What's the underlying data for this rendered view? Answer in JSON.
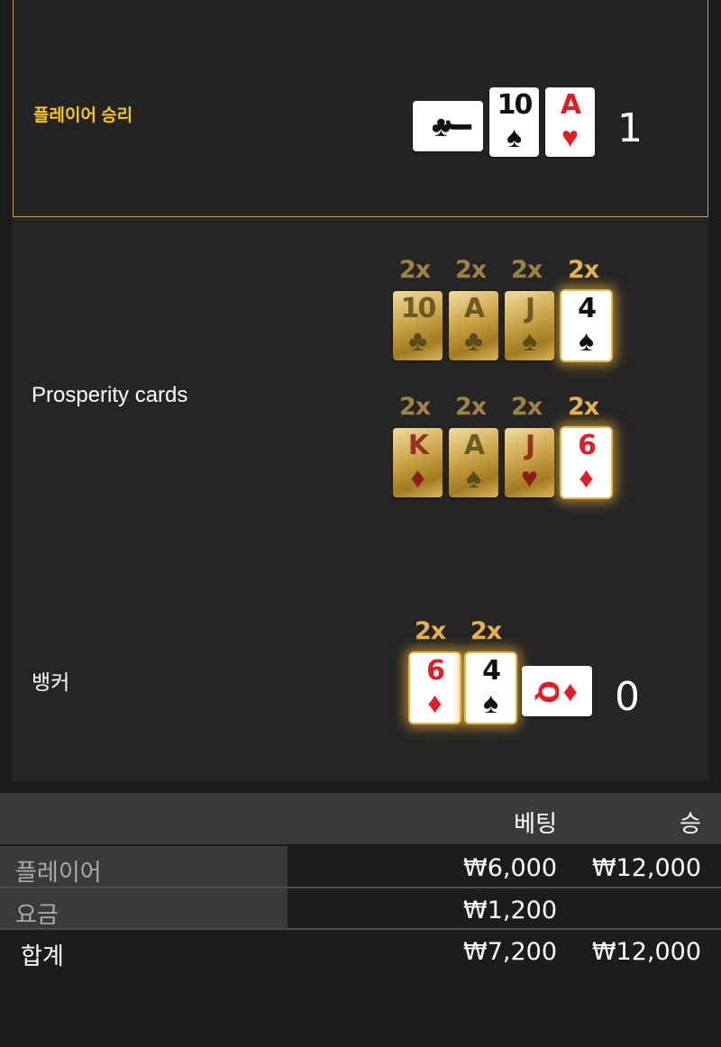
{
  "player": {
    "label": "플레이어 승리",
    "score": "1",
    "cards": [
      {
        "rank": "J",
        "suit": "♣",
        "color": "black",
        "orientation": "sideways"
      },
      {
        "rank": "10",
        "suit": "♠",
        "color": "black"
      },
      {
        "rank": "A",
        "suit": "♥",
        "color": "red"
      }
    ]
  },
  "prosperity": {
    "label": "Prosperity cards",
    "rows": [
      {
        "multipliers": [
          "2x",
          "2x",
          "2x",
          "2x"
        ],
        "cards": [
          {
            "rank": "10",
            "suit": "♣",
            "color": "black"
          },
          {
            "rank": "A",
            "suit": "♣",
            "color": "black"
          },
          {
            "rank": "J",
            "suit": "♠",
            "color": "black"
          },
          {
            "rank": "4",
            "suit": "♠",
            "color": "black",
            "highlight": true
          }
        ]
      },
      {
        "multipliers": [
          "2x",
          "2x",
          "2x",
          "2x"
        ],
        "cards": [
          {
            "rank": "K",
            "suit": "♦",
            "color": "red"
          },
          {
            "rank": "A",
            "suit": "♠",
            "color": "black"
          },
          {
            "rank": "J",
            "suit": "♥",
            "color": "red"
          },
          {
            "rank": "6",
            "suit": "♦",
            "color": "red",
            "highlight": true
          }
        ]
      }
    ]
  },
  "banker": {
    "label": "뱅커",
    "score": "0",
    "multipliers": [
      "2x",
      "2x"
    ],
    "cards": [
      {
        "rank": "6",
        "suit": "♦",
        "color": "red",
        "highlight": true
      },
      {
        "rank": "4",
        "suit": "♠",
        "color": "black",
        "highlight": true
      },
      {
        "rank": "Q",
        "suit": "♦",
        "color": "red",
        "orientation": "sideways"
      }
    ]
  },
  "summary": {
    "header": {
      "bet": "베팅",
      "win": "승"
    },
    "rows": [
      {
        "label": "플레이어",
        "bet": "₩6,000",
        "win": "₩12,000"
      },
      {
        "label": "요금",
        "bet": "₩1,200",
        "win": ""
      }
    ],
    "total": {
      "label": "합계",
      "bet": "₩7,200",
      "win": "₩12,000"
    }
  },
  "colors": {
    "accent": "#f5c518",
    "panel_border": "#c9a53a",
    "red_suit": "#e51c23",
    "gold_multiplier": "#e7b04a"
  }
}
